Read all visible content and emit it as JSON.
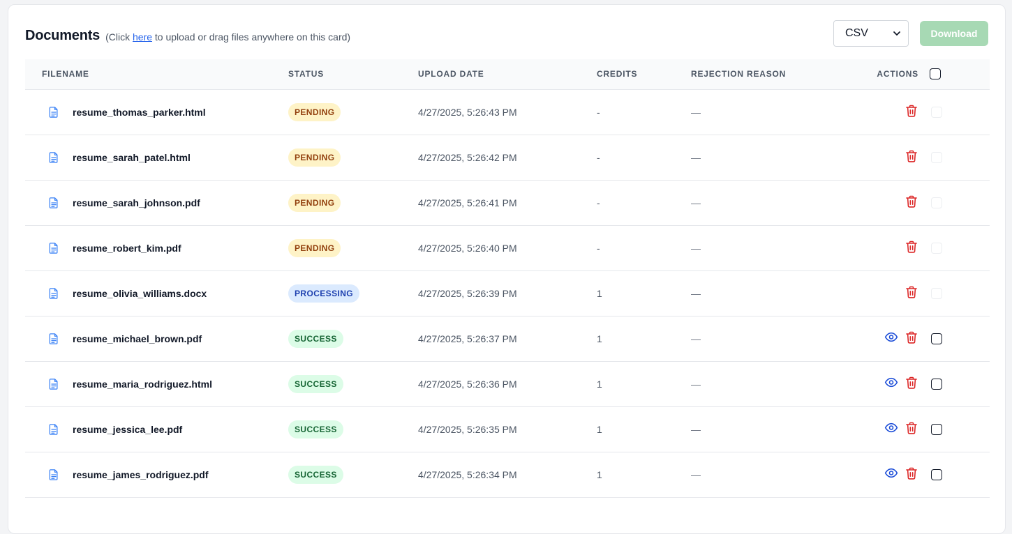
{
  "header": {
    "title": "Documents",
    "hint_prefix": "(Click ",
    "hint_link": "here",
    "hint_suffix": " to upload or drag files anywhere on this card)",
    "format_value": "CSV",
    "download_label": "Download"
  },
  "columns": {
    "filename": "FILENAME",
    "status": "STATUS",
    "upload_date": "UPLOAD DATE",
    "credits": "CREDITS",
    "rejection_reason": "REJECTION REASON",
    "actions": "ACTIONS"
  },
  "status_styles": {
    "PENDING": {
      "bg": "#fef3c7",
      "fg": "#92400e"
    },
    "PROCESSING": {
      "bg": "#dbeafe",
      "fg": "#1e40af"
    },
    "SUCCESS": {
      "bg": "#dcfce7",
      "fg": "#166534"
    }
  },
  "colors": {
    "file_icon": "#3b82f6",
    "view_icon": "#1d4ed8",
    "delete_icon": "#dc2626"
  },
  "rows": [
    {
      "filename": "resume_thomas_parker.html",
      "status": "PENDING",
      "date": "4/27/2025, 5:26:43 PM",
      "credits": "-",
      "reason": "—",
      "can_view": false,
      "selectable": false
    },
    {
      "filename": "resume_sarah_patel.html",
      "status": "PENDING",
      "date": "4/27/2025, 5:26:42 PM",
      "credits": "-",
      "reason": "—",
      "can_view": false,
      "selectable": false
    },
    {
      "filename": "resume_sarah_johnson.pdf",
      "status": "PENDING",
      "date": "4/27/2025, 5:26:41 PM",
      "credits": "-",
      "reason": "—",
      "can_view": false,
      "selectable": false
    },
    {
      "filename": "resume_robert_kim.pdf",
      "status": "PENDING",
      "date": "4/27/2025, 5:26:40 PM",
      "credits": "-",
      "reason": "—",
      "can_view": false,
      "selectable": false
    },
    {
      "filename": "resume_olivia_williams.docx",
      "status": "PROCESSING",
      "date": "4/27/2025, 5:26:39 PM",
      "credits": "1",
      "reason": "—",
      "can_view": false,
      "selectable": false
    },
    {
      "filename": "resume_michael_brown.pdf",
      "status": "SUCCESS",
      "date": "4/27/2025, 5:26:37 PM",
      "credits": "1",
      "reason": "—",
      "can_view": true,
      "selectable": true
    },
    {
      "filename": "resume_maria_rodriguez.html",
      "status": "SUCCESS",
      "date": "4/27/2025, 5:26:36 PM",
      "credits": "1",
      "reason": "—",
      "can_view": true,
      "selectable": true
    },
    {
      "filename": "resume_jessica_lee.pdf",
      "status": "SUCCESS",
      "date": "4/27/2025, 5:26:35 PM",
      "credits": "1",
      "reason": "—",
      "can_view": true,
      "selectable": true
    },
    {
      "filename": "resume_james_rodriguez.pdf",
      "status": "SUCCESS",
      "date": "4/27/2025, 5:26:34 PM",
      "credits": "1",
      "reason": "—",
      "can_view": true,
      "selectable": true
    }
  ]
}
